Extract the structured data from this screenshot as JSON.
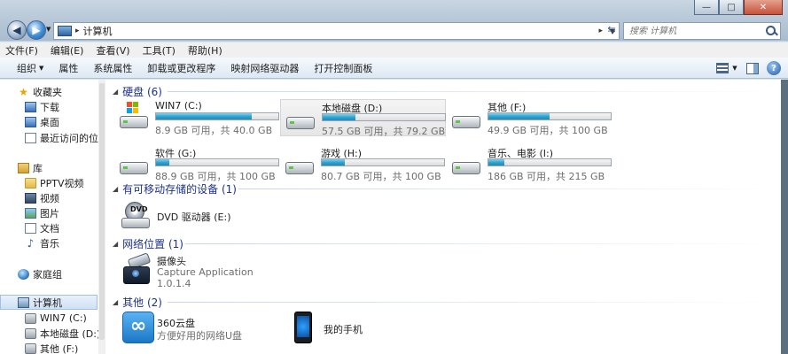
{
  "window": {
    "caption_buttons": [
      "—",
      "□",
      "✕"
    ]
  },
  "address": {
    "path": "计算机",
    "separator": "▸"
  },
  "search": {
    "placeholder": "搜索 计算机"
  },
  "menu": [
    "文件(F)",
    "编辑(E)",
    "查看(V)",
    "工具(T)",
    "帮助(H)"
  ],
  "commands": {
    "organize": "组织",
    "items": [
      "属性",
      "系统属性",
      "卸载或更改程序",
      "映射网络驱动器",
      "打开控制面板"
    ]
  },
  "sidebar": {
    "favorites": "收藏夹",
    "fav_items": [
      "下载",
      "桌面",
      "最近访问的位置"
    ],
    "libraries": "库",
    "lib_items": [
      "PPTV视频",
      "视频",
      "图片",
      "文档",
      "音乐"
    ],
    "homegroup": "家庭组",
    "computer": "计算机",
    "computer_items": [
      "WIN7 (C:)",
      "本地磁盘 (D:)",
      "其他 (F:)"
    ]
  },
  "groups": {
    "hdd": "硬盘 (6)",
    "removable": "有可移动存储的设备 (1)",
    "network": "网络位置 (1)",
    "other": "其他 (2)"
  },
  "drives": [
    {
      "name": "WIN7 (C:)",
      "info": "8.9 GB 可用，共 40.0 GB",
      "used_pct": 78,
      "system": true
    },
    {
      "name": "本地磁盘 (D:)",
      "info": "57.5 GB 可用，共 79.2 GB",
      "used_pct": 27,
      "system": false
    },
    {
      "name": "其他 (F:)",
      "info": "49.9 GB 可用，共 100 GB",
      "used_pct": 50,
      "system": false
    },
    {
      "name": "软件 (G:)",
      "info": "88.9 GB 可用，共 100 GB",
      "used_pct": 11,
      "system": false
    },
    {
      "name": "游戏 (H:)",
      "info": "80.7 GB 可用，共 100 GB",
      "used_pct": 19,
      "system": false
    },
    {
      "name": "音乐、电影 (I:)",
      "info": "186 GB 可用，共 215 GB",
      "used_pct": 13,
      "system": false
    }
  ],
  "dvd": {
    "name": "DVD 驱动器 (E:)",
    "label": "DVD"
  },
  "network_item": {
    "name": "摄像头",
    "desc": "Capture Application",
    "version": "1.0.1.4"
  },
  "other_items": [
    {
      "name": "360云盘",
      "desc": "方便好用的网络U盘"
    },
    {
      "name": "我的手机"
    }
  ],
  "colors": {
    "accent": "#1e3287",
    "bar_fill": "#2ba0cf"
  }
}
